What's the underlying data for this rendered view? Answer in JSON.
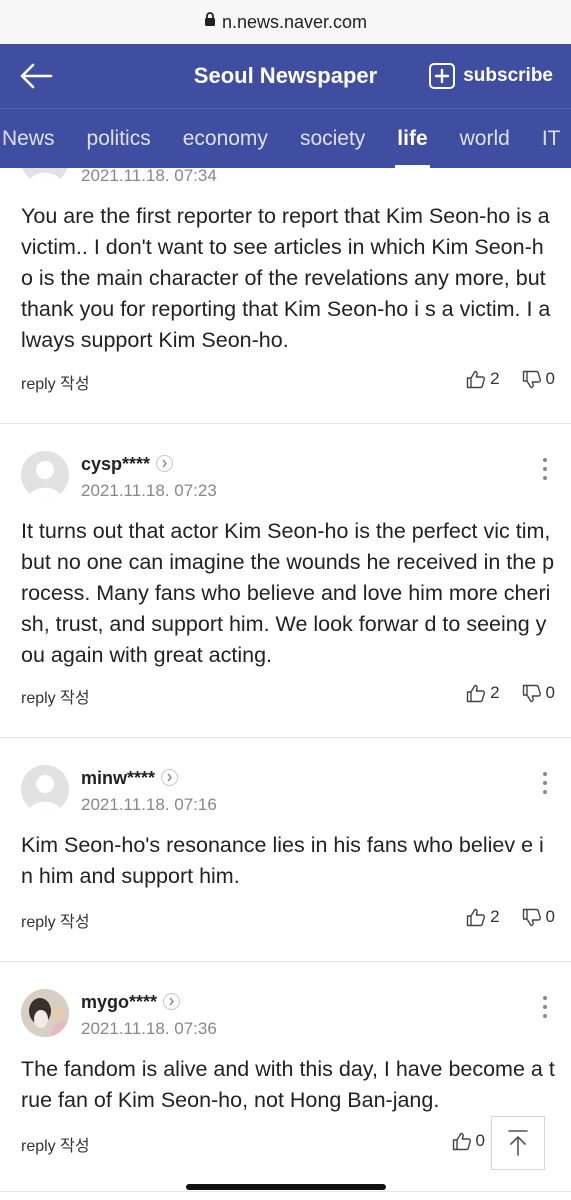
{
  "browser": {
    "url": "n.news.naver.com"
  },
  "header": {
    "title": "Seoul Newspaper",
    "subscribe_label": "subscribe"
  },
  "tabs": [
    {
      "label": "News",
      "active": false
    },
    {
      "label": "politics",
      "active": false
    },
    {
      "label": "economy",
      "active": false
    },
    {
      "label": "society",
      "active": false
    },
    {
      "label": "life",
      "active": true
    },
    {
      "label": "world",
      "active": false
    },
    {
      "label": "IT",
      "active": false
    }
  ],
  "comments": [
    {
      "author": "",
      "date": "2021.11.18. 07:34",
      "text": "You are the first reporter to report that Kim Seon-ho is a victim.. I don't want to see articles in which Kim Seon-ho is the main character of the revelations any more, but thank you for reporting that Kim Seon-ho i s a victim. I always support Kim Seon-ho.",
      "reply_label": "reply 작성",
      "likes": "2",
      "dislikes": "0"
    },
    {
      "author": "cysp****",
      "date": "2021.11.18. 07:23",
      "text": "It turns out that actor Kim Seon-ho is the perfect vic tim, but no one can imagine the wounds he received in the process. Many fans who believe and love him more cherish, trust, and support him. We look forwar d to seeing you again with great acting.",
      "reply_label": "reply 작성",
      "likes": "2",
      "dislikes": "0"
    },
    {
      "author": "minw****",
      "date": "2021.11.18. 07:16",
      "text": "Kim Seon-ho's resonance lies in his fans who believ e in him and support him.",
      "reply_label": "reply 작성",
      "likes": "2",
      "dislikes": "0"
    },
    {
      "author": "mygo****",
      "date": "2021.11.18. 07:36",
      "text": "The fandom is alive and with this day, I have become a true fan of Kim Seon-ho, not Hong Ban-jang.",
      "reply_label": "reply 작성",
      "likes": "0",
      "dislikes": ""
    }
  ],
  "colors": {
    "header_bg": "#3f4ea0",
    "tab_inactive": "#dde0f2",
    "date_gray": "#888888"
  }
}
